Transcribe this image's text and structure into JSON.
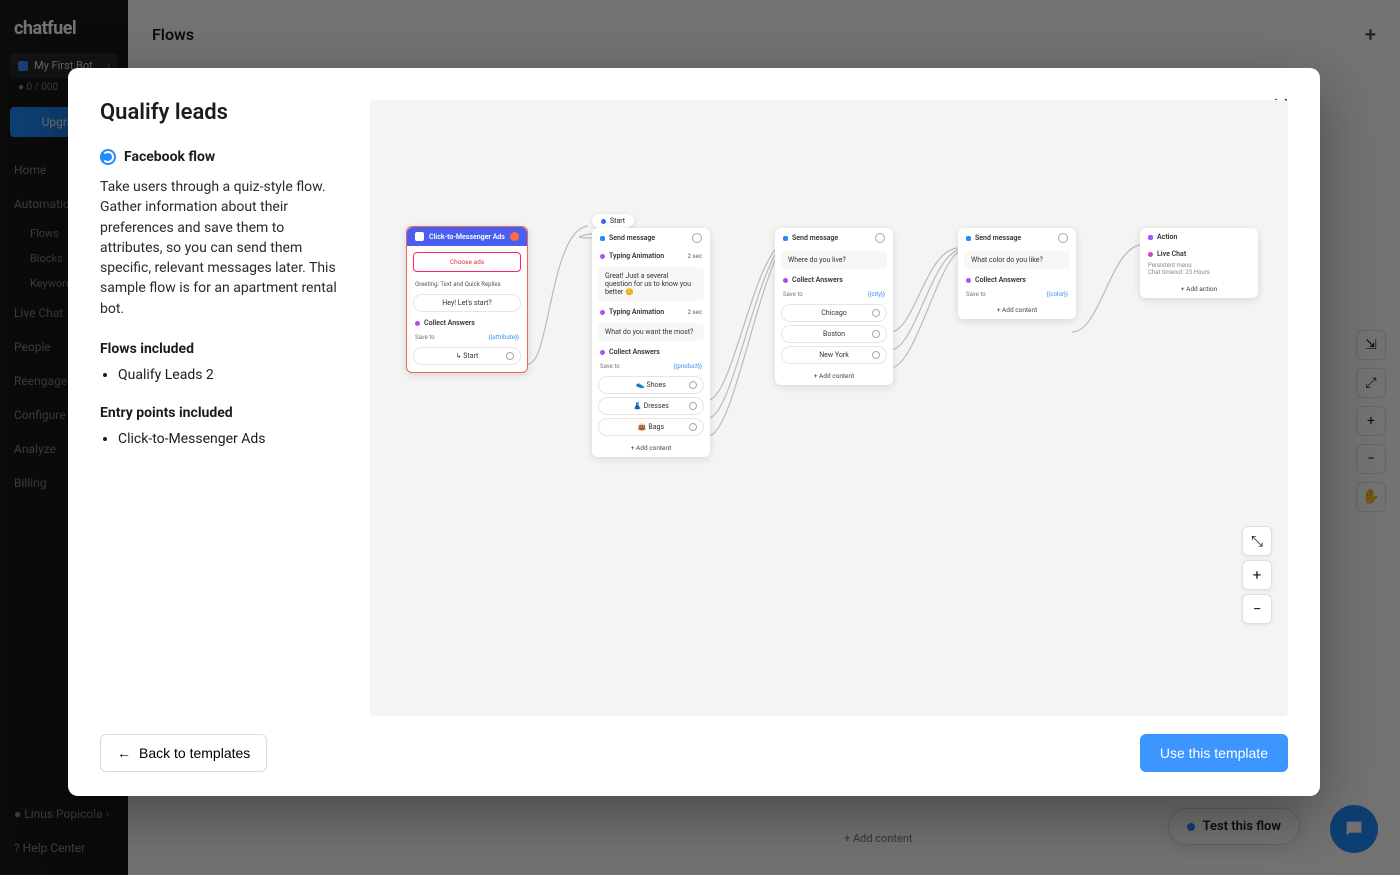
{
  "sidebar": {
    "logo": "chatfuel",
    "bot_name": "My First Bot",
    "bot_quota": "0 / 000",
    "upgrade": "Upgrade",
    "nav": {
      "home": "Home",
      "automation": "Automation",
      "flows": "Flows",
      "blocks": "Blocks",
      "keywords": "Keywords",
      "livechat": "Live Chat",
      "people": "People",
      "reengage": "Reengage",
      "configure": "Configure",
      "analyze": "Analyze",
      "billing": "Billing"
    },
    "user": "Linus Popicola",
    "help": "Help Center"
  },
  "flows_header": "Flows",
  "bg": {
    "test_flow": "Test this flow",
    "add_content": "+ Add content"
  },
  "modal": {
    "title": "Qualify leads",
    "flow_type": "Facebook flow",
    "description": "Take users through a quiz-style flow. Gather information about their preferences and save them to attributes, so you can send them specific, relevant messages later. This sample flow is for an apartment rental bot.",
    "flows_included_heading": "Flows included",
    "flows_included": [
      "Qualify Leads 2"
    ],
    "entry_heading": "Entry points included",
    "entry_points": [
      "Click-to-Messenger Ads"
    ],
    "back": "Back to templates",
    "use": "Use this template"
  },
  "preview": {
    "start": "Start",
    "card1": {
      "title": "Click-to-Messenger Ads",
      "choose": "Choose ads",
      "greeting": "Greeting: Text and Quick Replies",
      "hey": "Hey! Let's start?",
      "collect": "Collect Answers",
      "saveto": "Save to",
      "attr": "{{attribute}}",
      "start": "Start"
    },
    "card2": {
      "title": "Send message",
      "typing": "Typing Animation",
      "sec": "2 sec",
      "msg1": "Great! Just a several question for us to know you better 😊",
      "msg2": "What do you want the most?",
      "collect": "Collect Answers",
      "saveto": "Save to",
      "attr": "{{product}}",
      "opt1": "Shoes",
      "opt2": "Dresses",
      "opt3": "Bags",
      "add": "+ Add content"
    },
    "card3": {
      "title": "Send message",
      "q": "Where do you live?",
      "collect": "Collect Answers",
      "saveto": "Save to",
      "attr": "{{city}}",
      "opt1": "Chicago",
      "opt2": "Boston",
      "opt3": "New York",
      "add": "+ Add content"
    },
    "card4": {
      "title": "Send message",
      "q": "What color do you like?",
      "collect": "Collect Answers",
      "saveto": "Save to",
      "attr": "{{color}}",
      "add": "+ Add content"
    },
    "card5": {
      "title": "Action",
      "live": "Live Chat",
      "menu": "Persistent menu",
      "timeout": "Chat timeout: 23 Hours",
      "add": "+ Add action"
    }
  }
}
